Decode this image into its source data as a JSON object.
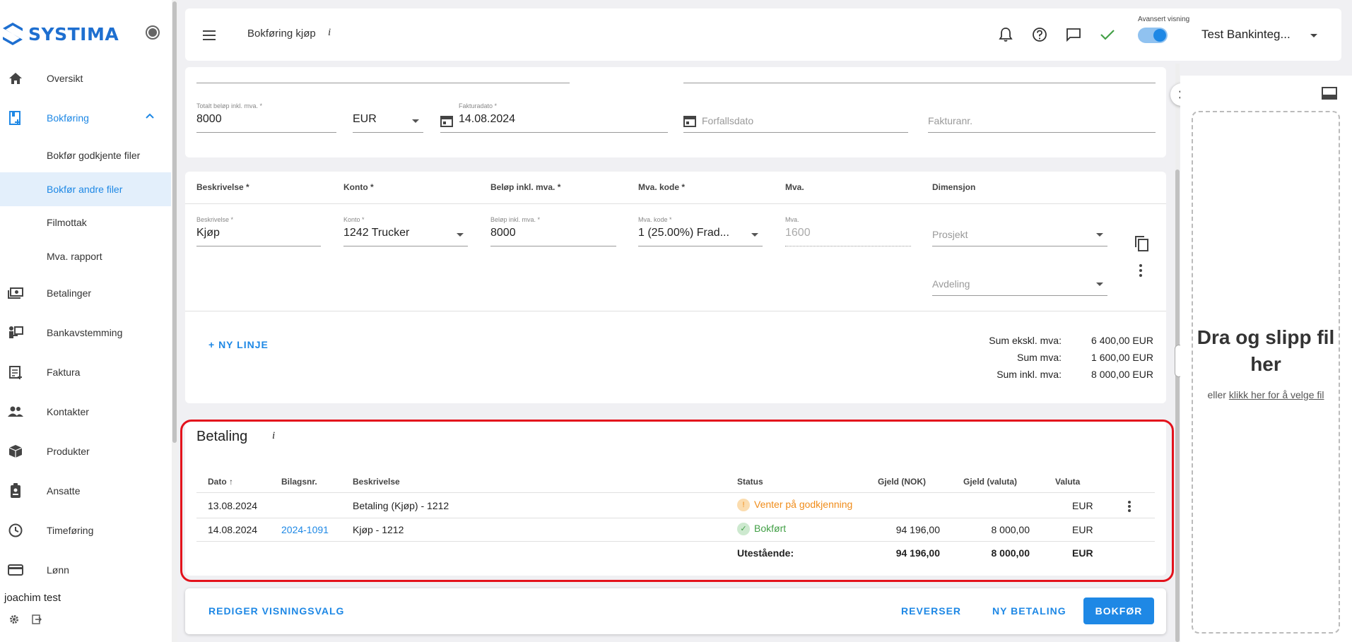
{
  "brand": {
    "name": "SYSTIMA"
  },
  "sidebar": {
    "items": [
      {
        "label": "Oversikt",
        "icon": "home-icon"
      },
      {
        "label": "Bokføring",
        "icon": "bookkeeping-icon"
      },
      {
        "label": "Bokfør godkjente filer"
      },
      {
        "label": "Bokfør andre filer"
      },
      {
        "label": "Filmottak"
      },
      {
        "label": "Mva. rapport"
      },
      {
        "label": "Betalinger",
        "icon": "payments-icon"
      },
      {
        "label": "Bankavstemming",
        "icon": "bank-reconcile-icon"
      },
      {
        "label": "Faktura",
        "icon": "invoice-icon"
      },
      {
        "label": "Kontakter",
        "icon": "contacts-icon"
      },
      {
        "label": "Produkter",
        "icon": "products-icon"
      },
      {
        "label": "Ansatte",
        "icon": "employees-icon"
      },
      {
        "label": "Timeføring",
        "icon": "clock-icon"
      },
      {
        "label": "Lønn",
        "icon": "card-icon"
      }
    ],
    "user": "joachim test"
  },
  "topbar": {
    "title": "Bokføring kjøp",
    "info": "i",
    "advanced_label": "Avansert visning",
    "company": "Test Bankinteg..."
  },
  "invoice": {
    "total_label": "Totalt beløp inkl. mva. *",
    "total_value": "8000",
    "currency": "EUR",
    "invoice_date_label": "Fakturadato *",
    "invoice_date": "14.08.2024",
    "due_date_placeholder": "Forfallsdato",
    "invoice_no_placeholder": "Fakturanr."
  },
  "lines": {
    "headers": [
      "Beskrivelse *",
      "Konto *",
      "Beløp inkl. mva. *",
      "Mva. kode *",
      "Mva.",
      "Dimensjon"
    ],
    "row": {
      "desc_label": "Beskrivelse *",
      "desc": "Kjøp",
      "konto_label": "Konto *",
      "konto": "1242 Trucker",
      "amount_label": "Beløp inkl. mva. *",
      "amount": "8000",
      "vat_code_label": "Mva. kode *",
      "vat_code": "1 (25.00%) Frad...",
      "vat_label": "Mva.",
      "vat": "1600",
      "project_placeholder": "Prosjekt",
      "department_placeholder": "Avdeling"
    },
    "new_line": "+ NY LINJE",
    "sums": [
      {
        "label": "Sum ekskl. mva:",
        "value": "6 400,00 EUR"
      },
      {
        "label": "Sum mva:",
        "value": "1 600,00 EUR"
      },
      {
        "label": "Sum inkl. mva:",
        "value": "8 000,00 EUR"
      }
    ]
  },
  "payment": {
    "title": "Betaling",
    "info": "i",
    "headers": [
      "Dato",
      "Bilagsnr.",
      "Beskrivelse",
      "Status",
      "Gjeld (NOK)",
      "Gjeld (valuta)",
      "Valuta"
    ],
    "sort_arrow": "↑",
    "rows": [
      {
        "date": "13.08.2024",
        "voucher": "",
        "desc": "Betaling (Kjøp) - 1212",
        "status": "Venter på godkjenning",
        "debt_nok": "",
        "debt_cur": "",
        "currency": "EUR"
      },
      {
        "date": "14.08.2024",
        "voucher": "2024-1091",
        "desc": "Kjøp - 1212",
        "status": "Bokført",
        "debt_nok": "94 196,00",
        "debt_cur": "8 000,00",
        "currency": "EUR"
      }
    ],
    "total": {
      "label": "Utestående:",
      "debt_nok": "94 196,00",
      "debt_cur": "8 000,00",
      "currency": "EUR"
    }
  },
  "actions": {
    "edit_view": "REDIGER VISNINGSVALG",
    "reverse": "REVERSER",
    "new_payment": "NY BETALING",
    "book": "BOKFØR"
  },
  "dropzone": {
    "title": "Dra og slipp fil her",
    "prefix": "eller ",
    "link": "klikk her for å velge fil"
  },
  "colors": {
    "accent": "#1e88e5",
    "warning": "#f08c1a",
    "success": "#43a047",
    "highlight": "#e3121c"
  }
}
